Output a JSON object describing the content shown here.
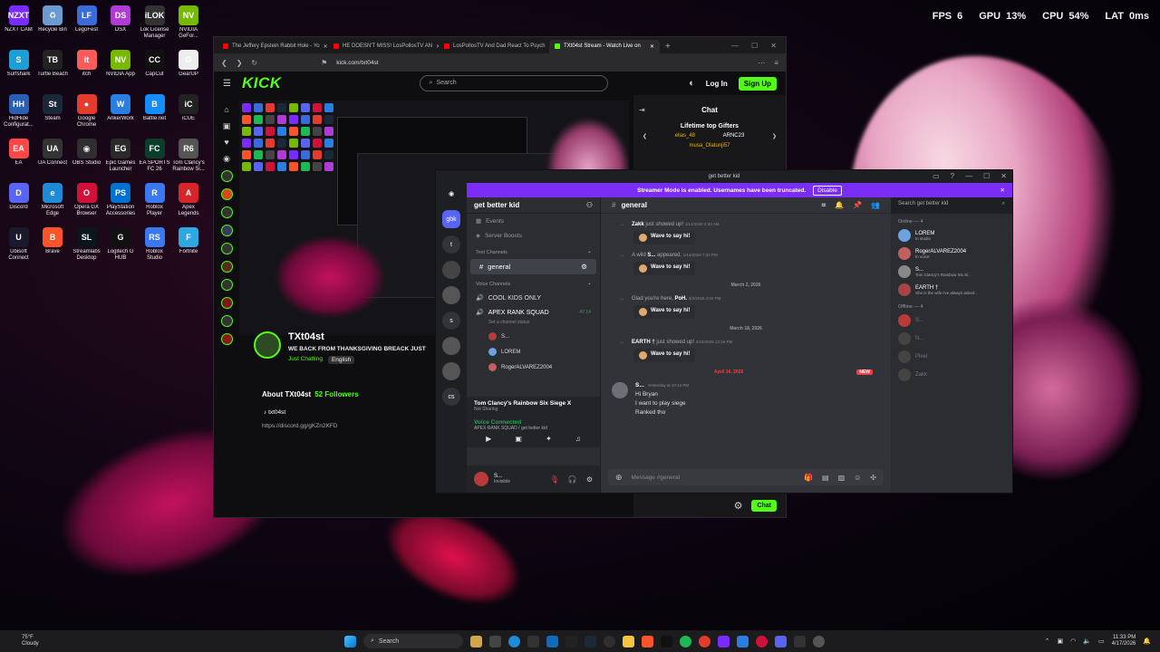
{
  "stats": {
    "fps_label": "FPS",
    "fps": "6",
    "gpu_label": "GPU",
    "gpu": "13%",
    "cpu_label": "CPU",
    "cpu": "54%",
    "lat_label": "LAT",
    "lat": "0ms"
  },
  "desktop_icons": [
    {
      "label": "NZXT CAM",
      "color": "#7a2bff",
      "glyph": "NZXT"
    },
    {
      "label": "Recycle Bin",
      "color": "#6b9bd1",
      "glyph": "♻"
    },
    {
      "label": "LegoFest",
      "color": "#3a6bd6",
      "glyph": "LF"
    },
    {
      "label": "DSX",
      "color": "#b13bd6",
      "glyph": "DS"
    },
    {
      "label": "Lok License Manager",
      "color": "#333",
      "glyph": "iLOK"
    },
    {
      "label": "NVIDIA GeFor...",
      "color": "#76b900",
      "glyph": "NV"
    },
    {
      "label": "",
      "color": "transparent",
      "glyph": ""
    },
    {
      "label": "",
      "color": "transparent",
      "glyph": ""
    },
    {
      "label": "Surfshark",
      "color": "#1c9fd6",
      "glyph": "S"
    },
    {
      "label": "Turtle Beach",
      "color": "#222",
      "glyph": "TB"
    },
    {
      "label": "itch",
      "color": "#fa5c5c",
      "glyph": "it"
    },
    {
      "label": "NVIDIA App",
      "color": "#76b900",
      "glyph": "NV"
    },
    {
      "label": "CapCut",
      "color": "#111",
      "glyph": "CC"
    },
    {
      "label": "GearUP",
      "color": "#eee",
      "glyph": "G"
    },
    {
      "label": "",
      "color": "transparent",
      "glyph": ""
    },
    {
      "label": "",
      "color": "transparent",
      "glyph": ""
    },
    {
      "label": "HidHide Configurat...",
      "color": "#2b5fb3",
      "glyph": "HH"
    },
    {
      "label": "Steam",
      "color": "#1b2838",
      "glyph": "St"
    },
    {
      "label": "Google Chrome",
      "color": "#e33b2e",
      "glyph": "●"
    },
    {
      "label": "AnkerWork",
      "color": "#2a7de1",
      "glyph": "W"
    },
    {
      "label": "Battle.net",
      "color": "#148eff",
      "glyph": "B"
    },
    {
      "label": "iCUE",
      "color": "#222",
      "glyph": "iC"
    },
    {
      "label": "",
      "color": "transparent",
      "glyph": ""
    },
    {
      "label": "",
      "color": "transparent",
      "glyph": ""
    },
    {
      "label": "EA",
      "color": "#ff4747",
      "glyph": "EA"
    },
    {
      "label": "UA Connect",
      "color": "#333",
      "glyph": "UA"
    },
    {
      "label": "OBS Studio",
      "color": "#302e31",
      "glyph": "◉"
    },
    {
      "label": "Epic Games Launcher",
      "color": "#2a2a2a",
      "glyph": "EG"
    },
    {
      "label": "EA SPORTS FC 26",
      "color": "#0a3d2a",
      "glyph": "FC"
    },
    {
      "label": "Tom Clancy's Rainbow Si...",
      "color": "#555",
      "glyph": "R6"
    },
    {
      "label": "",
      "color": "transparent",
      "glyph": ""
    },
    {
      "label": "",
      "color": "transparent",
      "glyph": ""
    },
    {
      "label": "Discord",
      "color": "#5865f2",
      "glyph": "D"
    },
    {
      "label": "Microsoft Edge",
      "color": "#1f8ad6",
      "glyph": "e"
    },
    {
      "label": "Opera GX Browser",
      "color": "#d0123b",
      "glyph": "O"
    },
    {
      "label": "PlayStation Accessories",
      "color": "#0070d1",
      "glyph": "PS"
    },
    {
      "label": "Roblox Player",
      "color": "#3a78f2",
      "glyph": "R"
    },
    {
      "label": "Apex Legends",
      "color": "#d6262b",
      "glyph": "A"
    },
    {
      "label": "",
      "color": "transparent",
      "glyph": ""
    },
    {
      "label": "",
      "color": "transparent",
      "glyph": ""
    },
    {
      "label": "Ubisoft Connect",
      "color": "#1a1a2e",
      "glyph": "U"
    },
    {
      "label": "Brave",
      "color": "#fb542b",
      "glyph": "B"
    },
    {
      "label": "Streamlabs Desktop",
      "color": "#09161d",
      "glyph": "SL"
    },
    {
      "label": "Logitech G HUB",
      "color": "#111",
      "glyph": "G"
    },
    {
      "label": "Roblox Studio",
      "color": "#3a78f2",
      "glyph": "RS"
    },
    {
      "label": "Fortnite",
      "color": "#2da8e0",
      "glyph": "F"
    },
    {
      "label": "",
      "color": "transparent",
      "glyph": ""
    },
    {
      "label": "",
      "color": "transparent",
      "glyph": ""
    }
  ],
  "browser": {
    "tabs": [
      {
        "label": "The Jeffery Epstein Rabbit Hole - Yo",
        "color": "#ff0000",
        "active": false
      },
      {
        "label": "HE DOESN'T MISS! LosPollosTV AN",
        "color": "#ff0000",
        "active": false
      },
      {
        "label": "LosPollosTV And Dad React To Psych",
        "color": "#ff0000",
        "active": false
      },
      {
        "label": "TXt04st Stream - Watch Live on",
        "color": "#53fc18",
        "active": true
      }
    ],
    "url": "kick.com/txt04st",
    "search_placeholder": "Search",
    "login": "Log In",
    "signup": "Sign Up",
    "logo": "KICK",
    "channel": {
      "name": "TXt04st",
      "title": "WE BACK FROM THANKSGIVING BREACK JUST",
      "category": "Just Chatting",
      "language": "English"
    },
    "about": {
      "title": "About TXt04st",
      "followers": "52 Followers",
      "tiktok": "txt04st",
      "link": "https://discord.gg/gKZn2KFD"
    },
    "chat": {
      "title": "Chat",
      "gifters_title": "Lifetime top Gifters",
      "gifter1": "elias_48",
      "gifter2": "ARNC23",
      "gifter3": "musa_Olatunji57",
      "button": "Chat"
    }
  },
  "discord": {
    "window_title": "get better kid",
    "streamer_text": "Streamer Mode is enabled. Usernames have been truncated.",
    "disable": "Disable",
    "server_name": "get better kid",
    "events": "Events",
    "boosts": "Server Boosts",
    "text_channels": "Text Channels",
    "general": "general",
    "voice_channels": "Voice Channels",
    "vc1": "COOL KIDS ONLY",
    "vc2": "APEX RANK SQUAD",
    "vc2_time": "47:14",
    "vc2_status": "Set a channel status",
    "vc_user1": "S...",
    "vc_user2": "LOREM",
    "vc_user3": "RogerALVAREZ2004",
    "game": "Tom Clancy's Rainbow Six Siege X",
    "game_sub": "Not Sharing",
    "voice_connected": "Voice Connected",
    "voice_sub": "APEX RANK SQUAD / get better kid",
    "user_name": "S...",
    "user_status": "Invisible",
    "channel_header": "general",
    "search_placeholder": "Search get better kid",
    "messages": [
      {
        "kind": "sys",
        "name": "Zakk",
        "text": "just showed up!",
        "time": "1/14/2026 4:33 AM"
      },
      {
        "kind": "sys",
        "name": "",
        "prefix": "A wild",
        "name2": "S...",
        "text": "appeared.",
        "time": "1/14/2026 7:33 PM"
      },
      {
        "kind": "date",
        "text": "March 2, 2026"
      },
      {
        "kind": "sys",
        "prefix": "Glad you're here,",
        "name": "PoH.",
        "text": "",
        "time": "3/2/2026 3:02 PM"
      },
      {
        "kind": "date",
        "text": "March 18, 2026"
      },
      {
        "kind": "sys",
        "name": "EARTH †",
        "text": "just showed up!",
        "time": "3/18/2026 12:15 PM"
      },
      {
        "kind": "date-new",
        "text": "April 16, 2026",
        "badge": "NEW"
      }
    ],
    "wave": "Wave to say hi!",
    "msg_user": "S...",
    "msg_time": "Yesterday at 10:42 PM",
    "msg_lines": [
      "Hi Bryan",
      "I want to play siege",
      "Ranked tho"
    ],
    "composer_placeholder": "Message #general",
    "online_label": "Online — 4",
    "offline_label": "Offline — 4",
    "members_online": [
      {
        "name": "LOREM",
        "sub": "In studio",
        "color": "#6aa3e0"
      },
      {
        "name": "RogerALVAREZ2004",
        "sub": "In voice",
        "color": "#c06060"
      },
      {
        "name": "S...",
        "sub": "Tom Clancy's Rainbow Six Si...",
        "color": "#888"
      },
      {
        "name": "EARTH †",
        "sub": "She is the wife i've always asked...",
        "color": "#aa4444"
      }
    ],
    "members_offline": [
      {
        "name": "S...",
        "color": "#b83a3a"
      },
      {
        "name": "N...",
        "color": "#444"
      },
      {
        "name": "Pixel",
        "color": "#444"
      },
      {
        "name": "Zakk",
        "color": "#444"
      }
    ]
  },
  "taskbar": {
    "temp": "75°F",
    "weather": "Cloudy",
    "search": "Search",
    "time": "11:33 PM",
    "date": "4/17/2026"
  }
}
